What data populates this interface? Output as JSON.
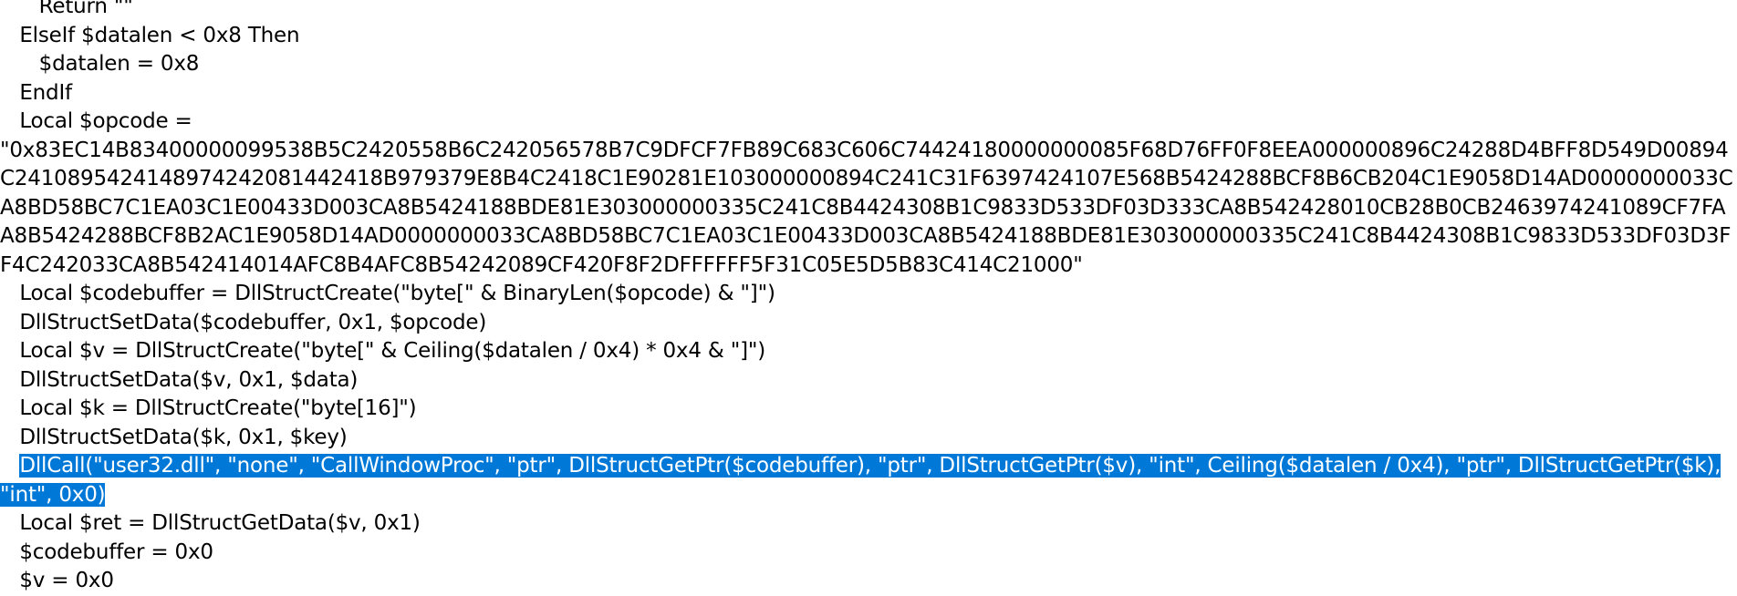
{
  "code": {
    "lines": [
      "      Return \"\"",
      "   ElseIf $datalen < 0x8 Then",
      "      $datalen = 0x8",
      "   EndIf",
      "   Local $opcode ="
    ],
    "opcode_string": "\"0x83EC14B83400000099538B5C2420558B6C242056578B7C9DFCF7FB89C683C606C74424180000000085F68D76FF0F8EEA000000896C24288D4BFF8D549D00894C2410895424148974242081442418B979379E8B4C2418C1E90281E103000000894C241C31F6397424107E568B5424288BCF8B6CB204C1E9058D14AD0000000033CA8BD58BC7C1EA03C1E00433D003CA8B5424188BDE81E303000000335C241C8B4424308B1C9833D533DF03D333CA8B542428010CB28B0CB2463974241089CF7FAA8B5424288BCF8B2AC1E9058D14AD0000000033CA8BD58BC7C1EA03C1E00433D003CA8B5424188BDE81E303000000335C241C8B4424308B1C9833D533DF03D3FF4C242033CA8B542414014AFC8B4AFC8B54242089CF420F8F2DFFFFFF5F31C05E5D5B83C414C21000\"",
    "lines_after": [
      "   Local $codebuffer = DllStructCreate(\"byte[\" & BinaryLen($opcode) & \"]\")",
      "   DllStructSetData($codebuffer, 0x1, $opcode)",
      "   Local $v = DllStructCreate(\"byte[\" & Ceiling($datalen / 0x4) * 0x4 & \"]\")",
      "   DllStructSetData($v, 0x1, $data)",
      "   Local $k = DllStructCreate(\"byte[16]\")",
      "   DllStructSetData($k, 0x1, $key)"
    ],
    "selected_indent": "   ",
    "selected_line_1": "DllCall(\"user32.dll\", \"none\", \"CallWindowProc\", \"ptr\", DllStructGetPtr($codebuffer), \"ptr\", DllStructGetPtr($v), \"int\", Ceiling($datalen / 0x4), \"ptr\", DllStructGetPtr($k),",
    "selected_line_2": "\"int\", 0x0)",
    "lines_end": [
      "   Local $ret = DllStructGetData($v, 0x1)",
      "   $codebuffer = 0x0",
      "   $v = 0x0"
    ]
  },
  "colors": {
    "selection_bg": "#0078d7",
    "selection_fg": "#ffffff",
    "text": "#000000",
    "background": "#ffffff"
  }
}
